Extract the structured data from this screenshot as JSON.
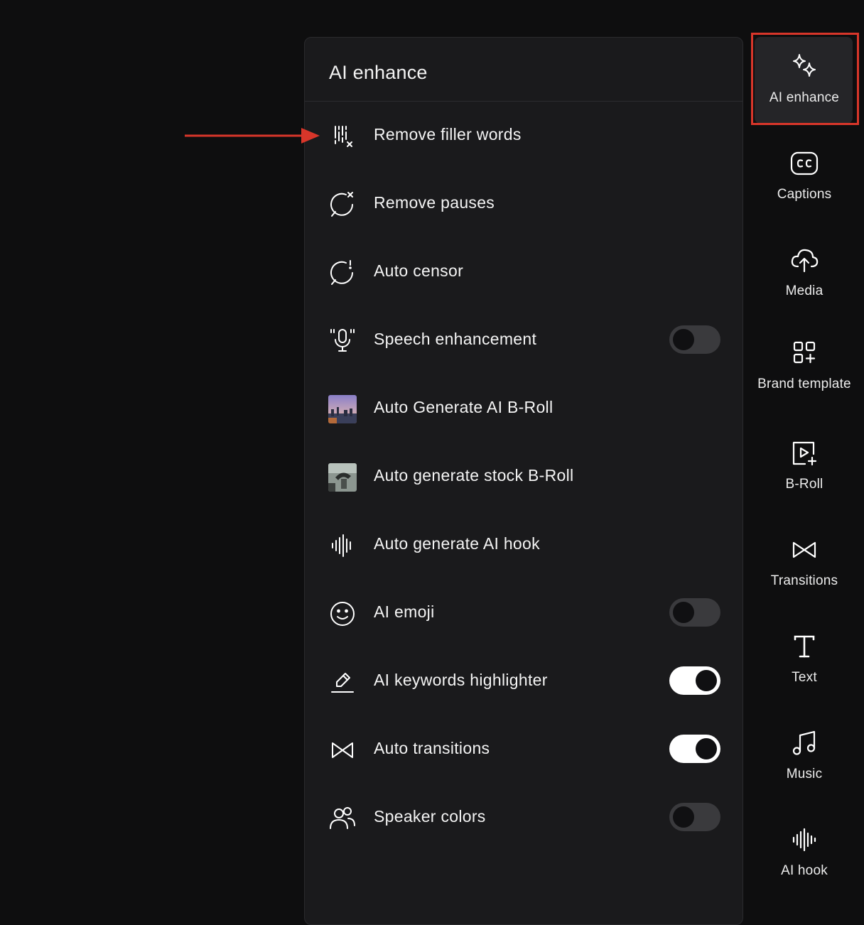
{
  "panel": {
    "title": "AI enhance",
    "items": [
      {
        "icon": "filler-words-icon",
        "label": "Remove filler words"
      },
      {
        "icon": "remove-pauses-icon",
        "label": "Remove pauses"
      },
      {
        "icon": "auto-censor-icon",
        "label": "Auto censor"
      },
      {
        "icon": "microphone-icon",
        "label": "Speech enhancement",
        "toggle": "off"
      },
      {
        "icon": "city-thumbnail",
        "label": "Auto Generate AI B-Roll"
      },
      {
        "icon": "stock-thumbnail",
        "label": "Auto generate stock B-Roll"
      },
      {
        "icon": "waveform-icon",
        "label": "Auto generate AI hook"
      },
      {
        "icon": "emoji-icon",
        "label": "AI emoji",
        "toggle": "off"
      },
      {
        "icon": "highlighter-icon",
        "label": "AI keywords highlighter",
        "toggle": "on"
      },
      {
        "icon": "transitions-icon",
        "label": "Auto transitions",
        "toggle": "on"
      },
      {
        "icon": "speakers-icon",
        "label": "Speaker colors",
        "toggle": "off"
      }
    ]
  },
  "sidebar": {
    "items": [
      {
        "icon": "sparkles-icon",
        "label": "AI enhance",
        "active": true
      },
      {
        "icon": "captions-icon",
        "label": "Captions"
      },
      {
        "icon": "cloud-upload-icon",
        "label": "Media"
      },
      {
        "icon": "grid-plus-icon",
        "label": "Brand template"
      },
      {
        "icon": "video-add-icon",
        "label": "B-Roll"
      },
      {
        "icon": "transitions-icon",
        "label": "Transitions"
      },
      {
        "icon": "text-icon",
        "label": "Text"
      },
      {
        "icon": "music-note-icon",
        "label": "Music"
      },
      {
        "icon": "waveform-icon",
        "label": "AI hook"
      }
    ]
  },
  "annotation": {
    "highlight_color": "#d8362a",
    "arrow_color": "#d8362a"
  },
  "colors": {
    "background": "#0e0e0f",
    "panel": "#1a1a1c",
    "toggle_on": "#ffffff",
    "toggle_off": "#3a3a3d"
  }
}
